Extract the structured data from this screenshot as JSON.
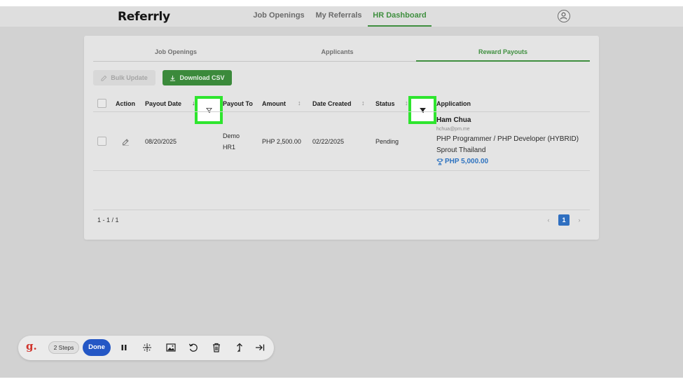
{
  "app": {
    "title": "Referrly"
  },
  "nav": {
    "items": [
      {
        "label": "Job Openings",
        "active": false
      },
      {
        "label": "My Referrals",
        "active": false
      },
      {
        "label": "HR Dashboard",
        "active": true
      }
    ],
    "profile_icon": "user-circle-icon"
  },
  "subtabs": [
    {
      "label": "Job Openings",
      "active": false
    },
    {
      "label": "Applicants",
      "active": false
    },
    {
      "label": "Reward Payouts",
      "active": true
    }
  ],
  "actions": {
    "bulk_update": "Bulk Update",
    "download_csv": "Download CSV"
  },
  "table": {
    "columns": [
      "Action",
      "Payout Date",
      "Payout To",
      "Amount",
      "Date Created",
      "Status",
      "Application"
    ],
    "sort_indicator_active": "↓",
    "sort_indicator": "↕",
    "rows": [
      {
        "payout_date": "08/20/2025",
        "payout_to_line1": "Demo",
        "payout_to_line2": "HR1",
        "amount": "PHP 2,500.00",
        "date_created": "02/22/2025",
        "status": "Pending",
        "application": {
          "name": "Ham Chua",
          "email": "hchua@pm.me",
          "job": "PHP Programmer / PHP Developer (HYBRID)",
          "company": "Sprout Thailand",
          "reward": "PHP 5,000.00"
        }
      }
    ]
  },
  "pagination": {
    "count": "1 - 1 / 1",
    "prev": "‹",
    "current": "1",
    "next": "›"
  },
  "recorder_toolbar": {
    "logo": "g.",
    "steps": "2 Steps",
    "done": "Done"
  },
  "colors": {
    "accent_green": "#3f8f3f",
    "highlight_green": "#2ee52e",
    "link_blue": "#2e73c0",
    "done_blue": "#2457c5"
  }
}
